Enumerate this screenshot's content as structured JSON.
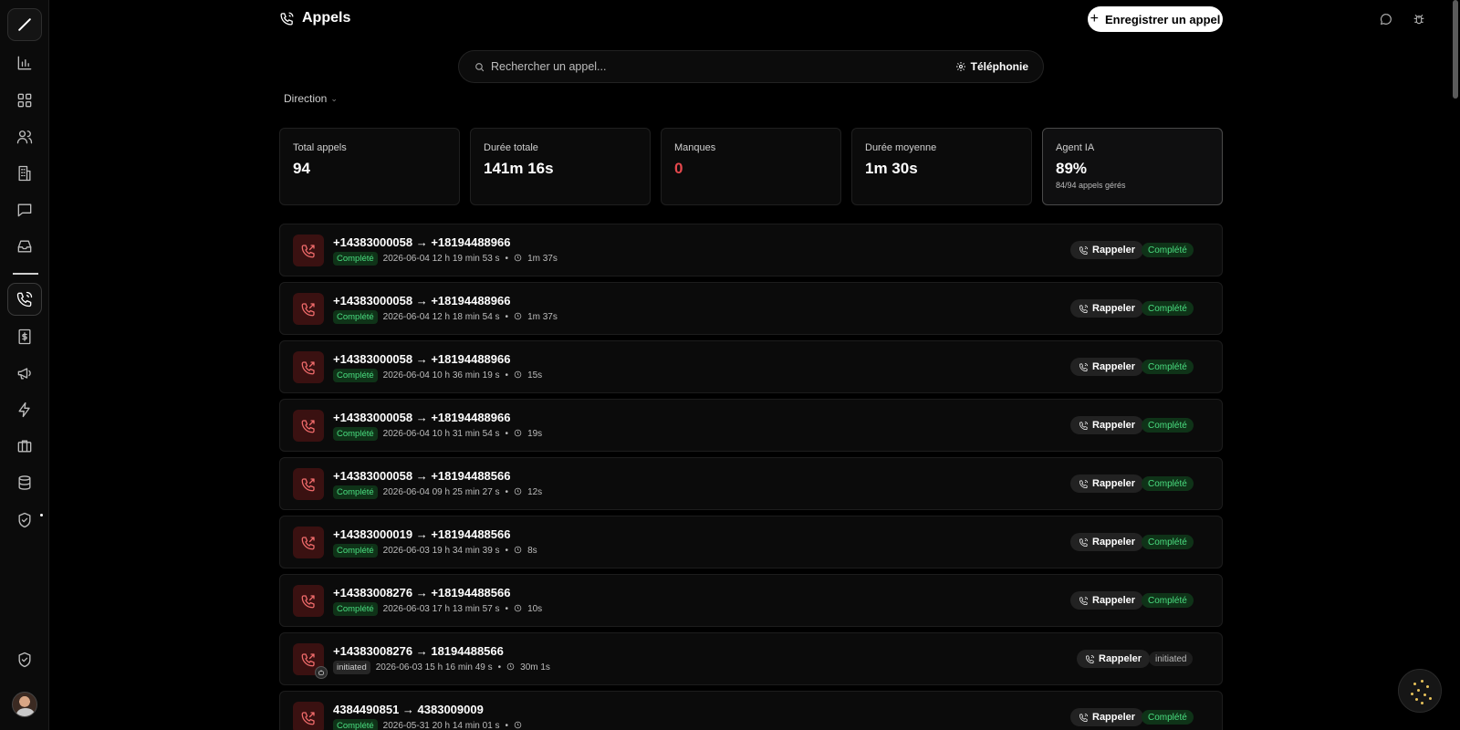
{
  "header": {
    "title": "Appels",
    "record_button": "Enregistrer un appel"
  },
  "search": {
    "placeholder": "Rechercher un appel...",
    "telephony_label": "Téléphonie"
  },
  "filters": {
    "direction_label": "Direction"
  },
  "stats": [
    {
      "label": "Total appels",
      "value": "94"
    },
    {
      "label": "Durée totale",
      "value": "141m 16s"
    },
    {
      "label": "Manques",
      "value": "0"
    },
    {
      "label": "Durée moyenne",
      "value": "1m 30s"
    },
    {
      "label": "Agent IA",
      "value": "89%",
      "sub": "84/94 appels gérés"
    }
  ],
  "calls": [
    {
      "number": "+14383000058 → +18194488966",
      "badge": "Complété",
      "date": "2026-06-04 12 h 19 min 53 s",
      "duration": "1m 37s",
      "action": "Rappeler",
      "status": "Complété"
    },
    {
      "number": "+14383000058 → +18194488966",
      "badge": "Complété",
      "date": "2026-06-04 12 h 18 min 54 s",
      "duration": "1m 37s",
      "action": "Rappeler",
      "status": "Complété"
    },
    {
      "number": "+14383000058 → +18194488966",
      "badge": "Complété",
      "date": "2026-06-04 10 h 36 min 19 s",
      "duration": "15s",
      "action": "Rappeler",
      "status": "Complété"
    },
    {
      "number": "+14383000058 → +18194488966",
      "badge": "Complété",
      "date": "2026-06-04 10 h 31 min 54 s",
      "duration": "19s",
      "action": "Rappeler",
      "status": "Complété"
    },
    {
      "number": "+14383000058 → +18194488566",
      "badge": "Complété",
      "date": "2026-06-04 09 h 25 min 27 s",
      "duration": "12s",
      "action": "Rappeler",
      "status": "Complété"
    },
    {
      "number": "+14383000019 → +18194488566",
      "badge": "Complété",
      "date": "2026-06-03 19 h 34 min 39 s",
      "duration": "8s",
      "action": "Rappeler",
      "status": "Complété"
    },
    {
      "number": "+14383008276 → +18194488566",
      "badge": "Complété",
      "date": "2026-06-03 17 h 13 min 57 s",
      "duration": "10s",
      "action": "Rappeler",
      "status": "Complété"
    },
    {
      "number": "+14383008276 → 18194488566",
      "badge": "initiated",
      "date": "2026-06-03 15 h 16 min 49 s",
      "duration": "30m 1s",
      "action": "Rappeler",
      "status": "initiated"
    },
    {
      "number": "4384490851 → 4383009009",
      "badge": "Complété",
      "date": "2026-05-31 20 h 14 min 01 s",
      "duration": "",
      "action": "Rappeler",
      "status": "Complété"
    }
  ],
  "icons": {
    "sidebar": [
      "logo-icon",
      "chart-icon",
      "grid-icon",
      "users-icon",
      "building-icon",
      "message-icon",
      "inbox-icon",
      "phone-icon",
      "invoice-icon",
      "megaphone-icon",
      "zap-icon",
      "briefcase-icon",
      "database-icon",
      "shield-check-icon",
      "shield-icon"
    ]
  },
  "colors": {
    "accent_red": "#e5484d",
    "success_green": "#4ade80",
    "background": "#000000"
  }
}
